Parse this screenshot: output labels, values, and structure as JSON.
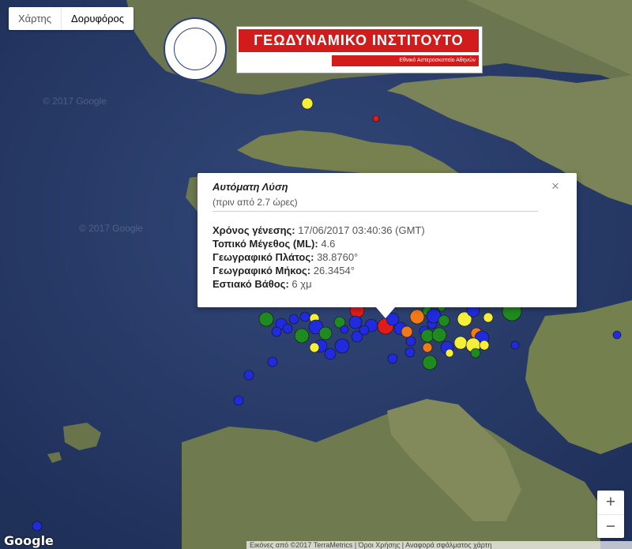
{
  "map_type": {
    "map_label": "Χάρτης",
    "satellite_label": "Δορυφόρος",
    "active": "satellite"
  },
  "logo": {
    "title": "ΓΕΩΔΥΝΑΜΙΚΟ ΙΝΣΤΙΤΟΥΤΟ",
    "subtitle": "Εθνικό Αστεροσκοπείο Αθηνών"
  },
  "popup": {
    "title": "Αυτόματη Λύση",
    "ago": "(πριν από 2.7 ώρες)",
    "rows": [
      {
        "label": "Χρόνος γένεσης:",
        "value": "17/06/2017  03:40:36 (GMT)"
      },
      {
        "label": "Τοπικό Μέγεθος (ML):",
        "value": "4.6"
      },
      {
        "label": "Γεωγραφικό Πλάτος:",
        "value": "38.8760°"
      },
      {
        "label": "Γεωγραφικό Μήκος:",
        "value": "26.3454°"
      },
      {
        "label": "Εστιακό Βάθος:",
        "value": "6 χμ"
      }
    ],
    "close": "×"
  },
  "zoom": {
    "in": "+",
    "out": "−"
  },
  "google_logo": "Google",
  "watermarks": [
    "© 2017 Google",
    "© 2017 Google"
  ],
  "attribution": "Εικόνες από ©2017 TerraMetrics  |  Όροι Χρήσης  |  Αναφορά σφάλματος χάρτη",
  "colors": {
    "sea": "#2c3f6e",
    "land": "#6f7a52",
    "mainshock": "#ff0000",
    "red": "#e11b1b",
    "blue": "#1f2bdc",
    "green": "#1f8a1f",
    "yellow": "#f4f03a",
    "orange": "#f07a18"
  }
}
